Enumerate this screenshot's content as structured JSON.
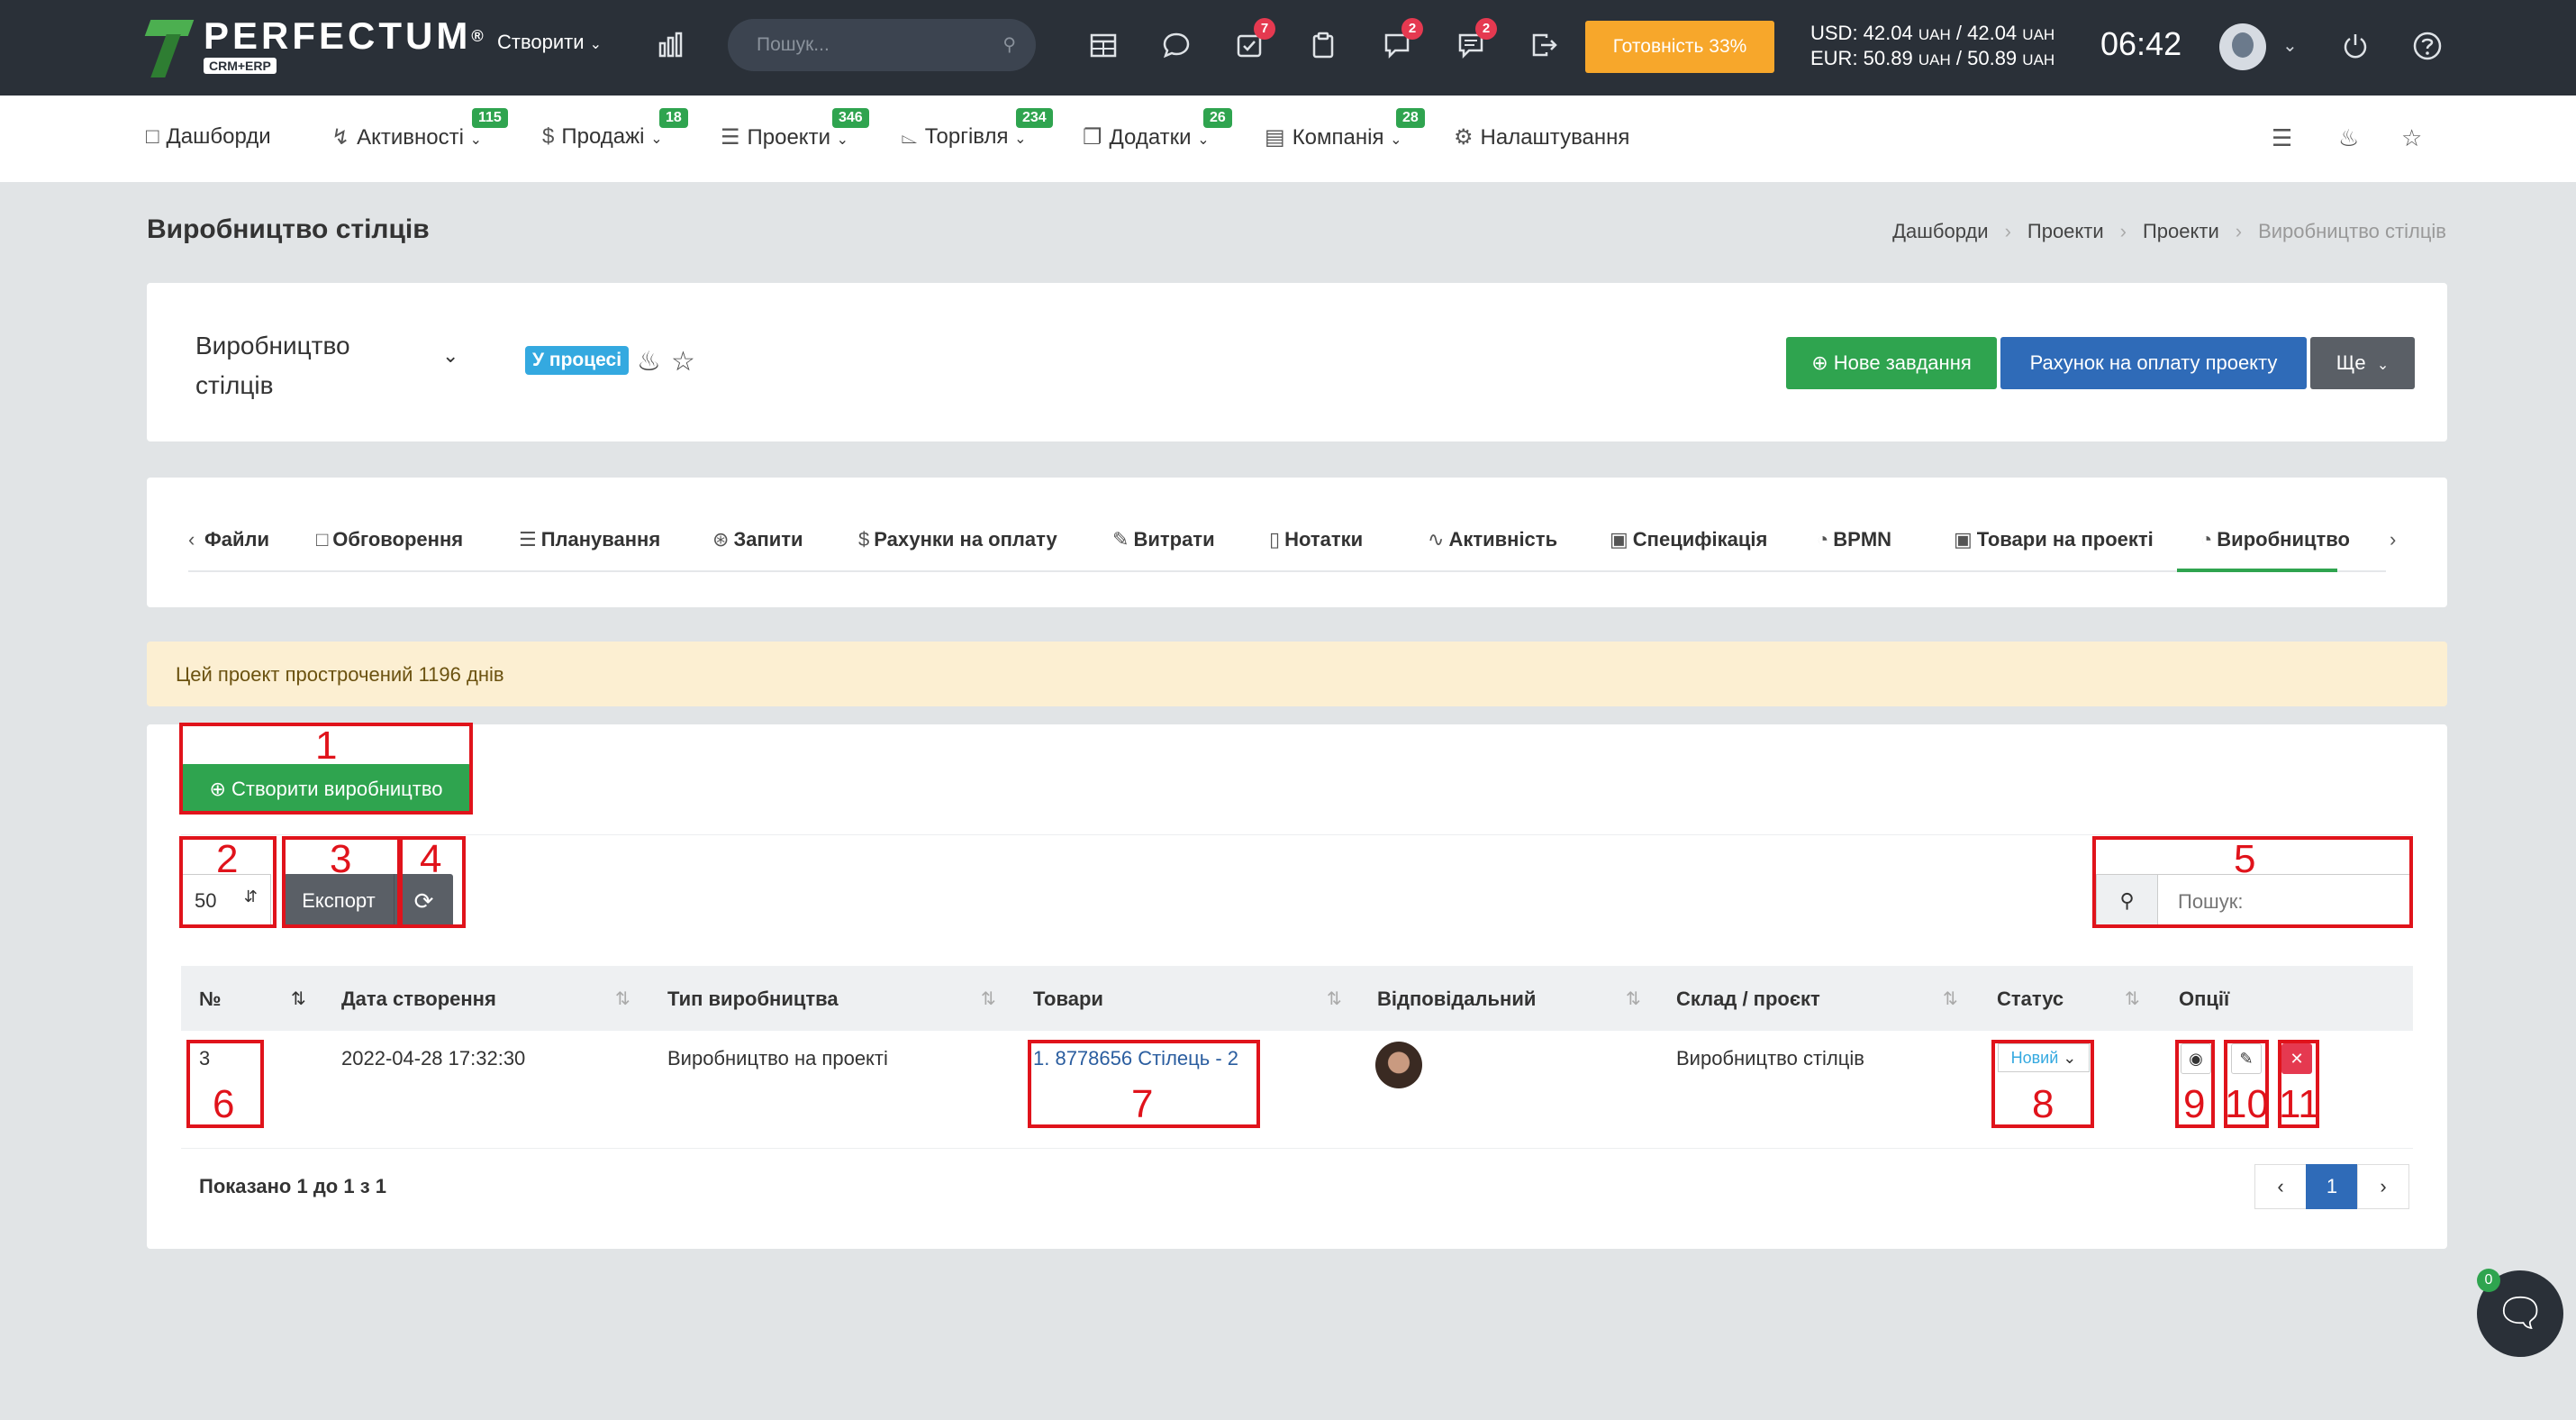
{
  "brand": {
    "name": "PERFECTUM",
    "sub": "CRM+ERP",
    "reg": "®"
  },
  "topbar": {
    "create_label": "Створити",
    "search_placeholder": "Пошук...",
    "badges": {
      "tasks": "7",
      "notifications": "2",
      "messages": "2"
    },
    "ready_label": "Готовність 33%",
    "rate_usd": "USD: 42.04",
    "rate_usd_2": "/ 42.04",
    "rate_eur": "EUR: 50.89",
    "rate_eur_2": "/ 50.89",
    "currency": "UAH",
    "time": "06:42"
  },
  "menu": {
    "items": [
      {
        "label": "Дашборди",
        "icon": "monitor-icon",
        "badge": ""
      },
      {
        "label": "Активності",
        "icon": "lightning-icon",
        "badge": "115"
      },
      {
        "label": "Продажі",
        "icon": "dollar-icon",
        "badge": "18"
      },
      {
        "label": "Проекти",
        "icon": "layers-icon",
        "badge": "346"
      },
      {
        "label": "Торгівля",
        "icon": "cart-icon",
        "badge": "234"
      },
      {
        "label": "Додатки",
        "icon": "copy-icon",
        "badge": "26"
      },
      {
        "label": "Компанія",
        "icon": "briefcase-icon",
        "badge": "28"
      },
      {
        "label": "Налаштування",
        "icon": "gear-icon",
        "badge": ""
      }
    ]
  },
  "page": {
    "title": "Виробництво стілців",
    "breadcrumb": [
      "Дашборди",
      "Проекти",
      "Проекти",
      "Виробництво стілців"
    ]
  },
  "project": {
    "name": "Виробництво стілців",
    "status": "У процесі",
    "new_task": "Нове завдання",
    "invoice": "Рахунок на оплату проекту",
    "more": "Ще"
  },
  "tabs": [
    {
      "label": "Файли",
      "icon": "file-icon"
    },
    {
      "label": "Обговорення",
      "icon": "comment-icon"
    },
    {
      "label": "Планування",
      "icon": "list-icon"
    },
    {
      "label": "Запити",
      "icon": "support-icon"
    },
    {
      "label": "Рахунки на оплату",
      "icon": "dollar-icon"
    },
    {
      "label": "Витрати",
      "icon": "edit-icon"
    },
    {
      "label": "Нотатки",
      "icon": "book-icon"
    },
    {
      "label": "Активність",
      "icon": "activity-icon"
    },
    {
      "label": "Специфікація",
      "icon": "box-icon"
    },
    {
      "label": "BPMN",
      "icon": "pie-icon"
    },
    {
      "label": "Товари на проекті",
      "icon": "box-icon"
    },
    {
      "label": "Виробництво",
      "icon": "pie-icon"
    }
  ],
  "alert": "Цей проект прострочений 1196 днів",
  "production": {
    "create_label": "Створити виробництво",
    "page_size": "50",
    "export_label": "Експорт",
    "search_label": "Пошук:",
    "columns": [
      "№",
      "Дата створення",
      "Тип виробництва",
      "Товари",
      "Відповідальний",
      "Склад / проєкт",
      "Статус",
      "Опції"
    ],
    "rows": [
      {
        "num": "3",
        "date": "2022-04-28 17:32:30",
        "type": "Виробництво на проекті",
        "goods": "1. 8778656 Стілець - 2",
        "warehouse": "Виробництво стілців",
        "status": "Новий"
      }
    ],
    "shown": "Показано 1 до 1 з 1",
    "page": "1"
  },
  "annotations": [
    "1",
    "2",
    "3",
    "4",
    "5",
    "6",
    "7",
    "8",
    "9",
    "10",
    "11"
  ],
  "chat_badge": "0",
  "colors": {
    "topbar": "#2a3038",
    "accent_green": "#2fa44f",
    "accent_blue": "#2f6bb8",
    "ready": "#f7a72b",
    "annotation": "#e0131b",
    "status_pill": "#34a9e0"
  }
}
